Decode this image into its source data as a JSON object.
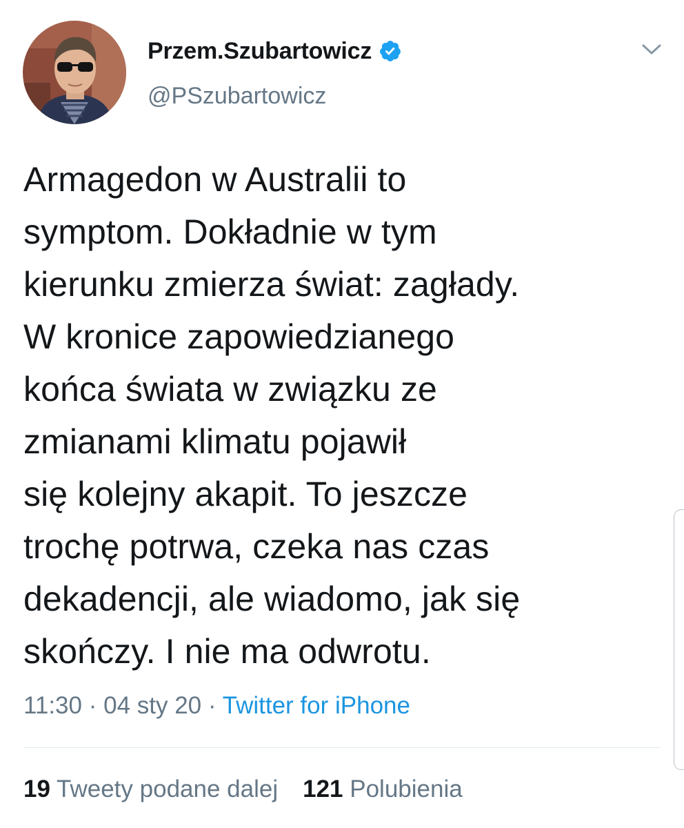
{
  "tweet": {
    "author": {
      "display_name": "Przem.Szubartowicz",
      "handle": "@PSzubartowicz",
      "verified": true,
      "verified_icon": "verified-badge-icon",
      "avatar_icon": "profile-photo"
    },
    "text": "Armagedon w Australii to\nsymptom. Dokładnie w tym\nkierunku zmierza świat: zagłady.\nW kronice zapowiedzianego\nkońca świata w związku ze\nzmianami klimatu pojawił\nsię kolejny akapit. To jeszcze\ntrochę potrwa, czeka nas czas\ndekadencji, ale wiadomo, jak się\nskończy. I nie ma odwrotu.",
    "time": "11:30",
    "separator": " · ",
    "date": "04 sty 20",
    "source": "Twitter for iPhone",
    "retweets": {
      "count": "19",
      "label": "Tweety podane dalej"
    },
    "likes": {
      "count": "121",
      "label": "Polubienia"
    },
    "menu_icon": "chevron-down-icon"
  },
  "colors": {
    "text": "#14171a",
    "secondary": "#657786",
    "link": "#1b95e0",
    "verified": "#1da1f2",
    "divider": "#e1e8ed"
  }
}
